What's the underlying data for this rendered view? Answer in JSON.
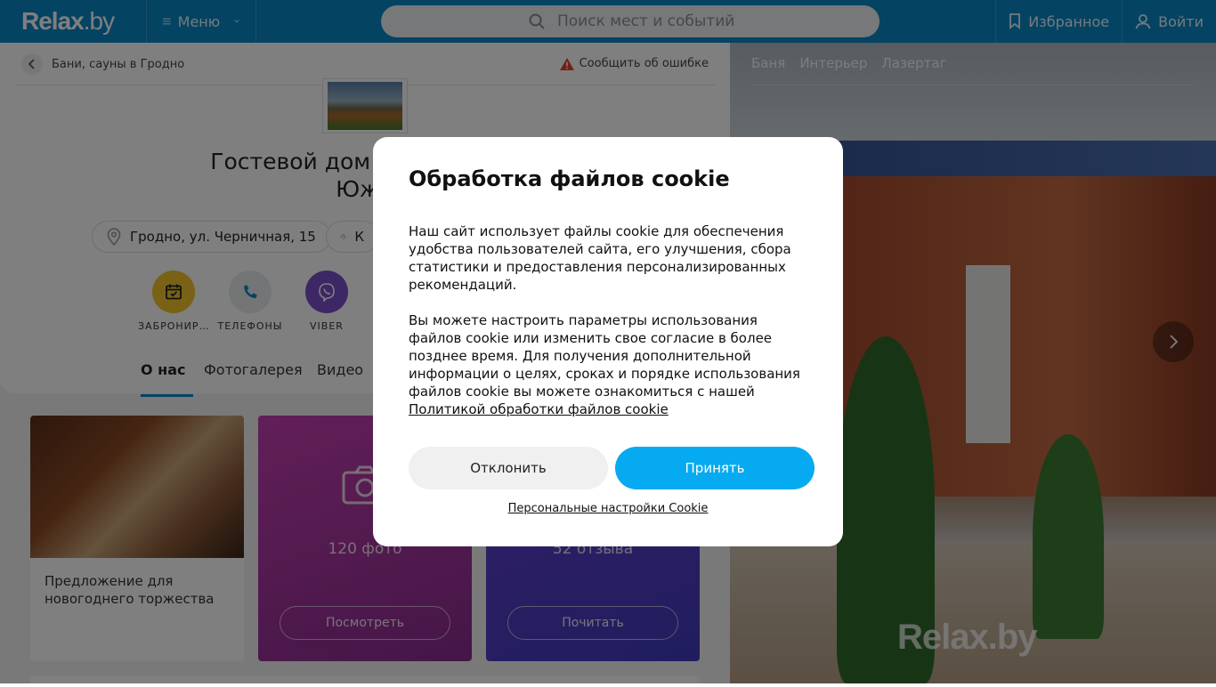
{
  "header": {
    "logo_main": "Relax",
    "logo_dot": ".by",
    "menu_label": "Меню",
    "search_placeholder": "Поиск мест и событий",
    "favorites_label": "Избранное",
    "login_label": "Войти",
    "brand_color": "#0a87c6"
  },
  "breadcrumb": {
    "label": "Бани, сауны в Гродно"
  },
  "report": {
    "label": "Сообщить об ошибке"
  },
  "place": {
    "title_line1": "Гостевой дом «Баня на ЧЕ",
    "title_line2": "Южн",
    "address": "Гродно, ул. Черничная, 15",
    "hours_chip": "К"
  },
  "actions": [
    {
      "label": "ЗАБРОНИР...",
      "icon": "calendar-check-icon",
      "color": "#f3c52a"
    },
    {
      "label": "ТЕЛЕФОНЫ",
      "icon": "phone-icon",
      "color": "#e8ebee"
    },
    {
      "label": "VIBER",
      "icon": "viber-icon",
      "color": "#7a4fc8"
    }
  ],
  "tabs": [
    {
      "label": "О нас",
      "active": true
    },
    {
      "label": "Фотогалерея",
      "active": false
    },
    {
      "label": "Видео",
      "active": false
    }
  ],
  "tiles": {
    "offer_text": "Предложение для новогоднего торжества",
    "photos_count": "120 фото",
    "photos_button": "Посмотреть",
    "reviews_count": "52 отзыва",
    "reviews_button": "Почитать"
  },
  "gallery": {
    "tabs": [
      "Баня",
      "Интерьер",
      "Лазертаг"
    ],
    "watermark": "Relax.by"
  },
  "cookie": {
    "title": "Обработка файлов cookie",
    "para1": "Наш сайт использует файлы cookie для обеспечения удобства пользователей сайта, его улучшения, сбора статистики и предоставления персонализированных рекомендаций.",
    "para2": "Вы можете настроить параметры использования файлов cookie или изменить свое согласие в более позднее время. Для получения дополнительной информации о целях, сроках и порядке использования файлов cookie вы можете ознакомиться с нашей",
    "policy_link": "Политикой обработки файлов cookie",
    "decline": "Отклонить",
    "accept": "Принять",
    "personal": "Персональные настройки Cookie",
    "accept_color": "#06aaf0"
  }
}
